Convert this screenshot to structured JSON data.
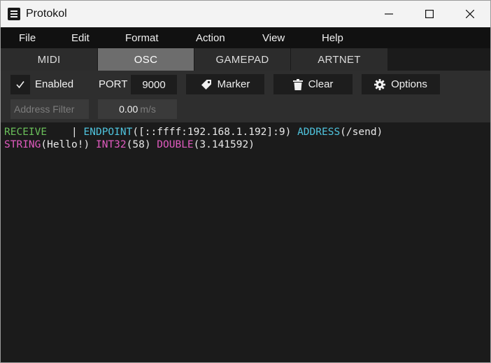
{
  "window": {
    "title": "Protokol"
  },
  "icons": {
    "app": "hamburger-app-icon",
    "minimize": "minimize-icon",
    "maximize": "maximize-icon",
    "close": "close-icon",
    "check": "checkmark-icon",
    "marker": "tag-icon",
    "clear": "trash-icon",
    "options": "gear-icon"
  },
  "menu": [
    "File",
    "Edit",
    "Format",
    "Action",
    "View",
    "Help"
  ],
  "tabs": [
    {
      "label": "MIDI",
      "active": false
    },
    {
      "label": "OSC",
      "active": true
    },
    {
      "label": "GAMEPAD",
      "active": false
    },
    {
      "label": "ARTNET",
      "active": false
    }
  ],
  "toolbar": {
    "enabled_checked": true,
    "enabled_label": "Enabled",
    "port_label": "PORT",
    "port_value": "9000",
    "marker_label": "Marker",
    "clear_label": "Clear",
    "options_label": "Options",
    "filter_placeholder": "Address Filter",
    "speed_value": "0.00",
    "speed_unit": "m/s"
  },
  "log": {
    "line1": {
      "direction": "RECEIVE",
      "separator": "    | ",
      "endpoint_key": "ENDPOINT",
      "endpoint_value": "([::ffff:192.168.1.192]:9)",
      "address_key": "ADDRESS",
      "address_value": "(/send)"
    },
    "line2": {
      "string_key": "STRING",
      "string_value": "(Hello!)",
      "int_key": "INT32",
      "int_value": "(58)",
      "double_key": "DOUBLE",
      "double_value": "(3.141592)"
    }
  },
  "colors": {
    "receive": "#6abf5a",
    "key_cyan": "#4fc3dd",
    "key_pink": "#e05bbf",
    "active_tab": "#6d6d6d"
  }
}
